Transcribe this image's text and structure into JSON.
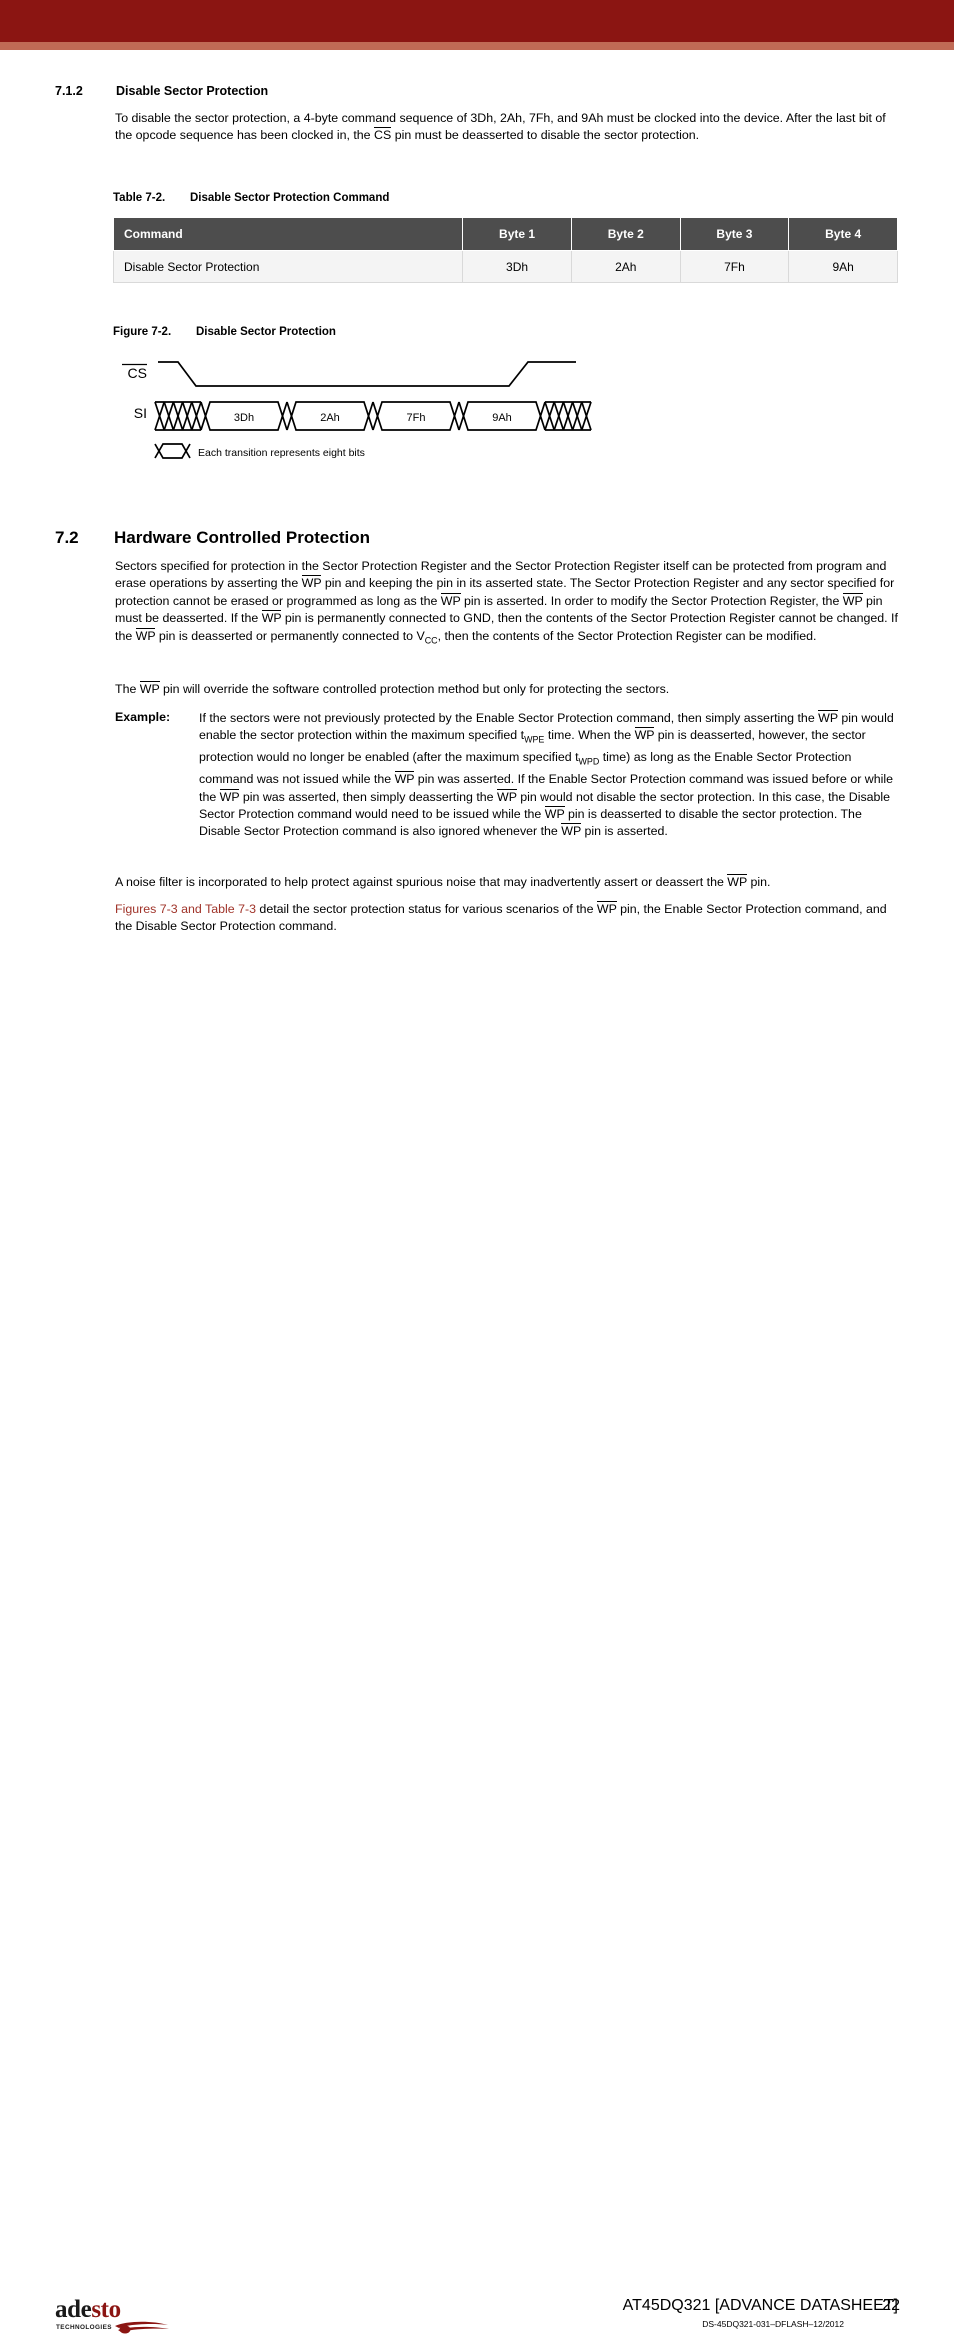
{
  "header": {
    "band_color_dark": "#8b1512",
    "band_color_light": "#c06a55"
  },
  "section_712": {
    "number": "7.1.2",
    "title": "Disable Sector Protection",
    "paragraph": "To disable the sector protection, a 4-byte command sequence of 3Dh, 2Ah, 7Fh, and 9Ah must be clocked into the device. After the last bit of the opcode sequence has been clocked in, the CS pin must be deasserted to disable the sector protection."
  },
  "table": {
    "caption_number": "Table 7-2.",
    "caption_text": "Disable Sector Protection Command",
    "header_bg": "#4d4d4d",
    "row_bg": "#f4f4f4",
    "columns": [
      "Command",
      "Byte 1",
      "Byte 2",
      "Byte 3",
      "Byte 4"
    ],
    "rows": [
      [
        "Disable Sector Protection",
        "3Dh",
        "2Ah",
        "7Fh",
        "9Ah"
      ]
    ]
  },
  "figure": {
    "caption_number": "Figure 7-2.",
    "caption_text": "Disable Sector Protection",
    "signals": {
      "cs_label": "CS",
      "si_label": "SI"
    },
    "si_bytes": [
      "3Dh",
      "2Ah",
      "7Fh",
      "9Ah"
    ],
    "legend_text": "Each transition represents eight bits"
  },
  "section_72": {
    "number": "7.2",
    "title": "Hardware Controlled Protection",
    "paragraph_1": "Sectors specified for protection in the Sector Protection Register and the Sector Protection Register itself can be protected from program and erase operations by asserting the WP pin and keeping the pin in its asserted state. The Sector Protection Register and any sector specified for protection cannot be erased or programmed as long as the WP pin is asserted. In order to modify the Sector Protection Register, the WP pin must be deasserted. If the WP pin is permanently connected to GND, then the contents of the Sector Protection Register cannot be changed. If the WP pin is deasserted or permanently connected to VCC, then the contents of the Sector Protection Register can be modified.",
    "paragraph_2": "The WP pin will override the software controlled protection method but only for protecting the sectors.",
    "example_label": "Example:",
    "example_text": "If the sectors were not previously protected by the Enable Sector Protection command, then simply asserting the WP pin would enable the sector protection within the maximum specified tWPE time. When the WP pin is deasserted, however, the sector protection would no longer be enabled (after the maximum specified tWPD time) as long as the Enable Sector Protection command was not issued while the WP pin was asserted. If the Enable Sector Protection command was issued before or while the WP pin was asserted, then simply deasserting the WP pin would not disable the sector protection. In this case, the Disable Sector Protection command would need to be issued while the WP pin is deasserted to disable the sector protection. The Disable Sector Protection command is also ignored whenever the WP pin is asserted.",
    "paragraph_3": "A noise filter is incorporated to help protect against spurious noise that may inadvertently assert or deassert the WP pin.",
    "paragraph_4_link": "Figures 7-3 and Table 7-3",
    "paragraph_4_rest": " detail the sector protection status for various scenarios of the WP pin, the Enable Sector Protection command, and the Disable Sector Protection command.",
    "link_color": "#a0342a"
  },
  "footer": {
    "logo_text_black": "ade",
    "logo_text_red": "sto",
    "logo_subtitle": "TECHNOLOGIES",
    "title": "AT45DQ321 [ADVANCE DATASHEET]",
    "page_number": "22",
    "doc_id": "DS-45DQ321-031–DFLASH–12/2012"
  }
}
